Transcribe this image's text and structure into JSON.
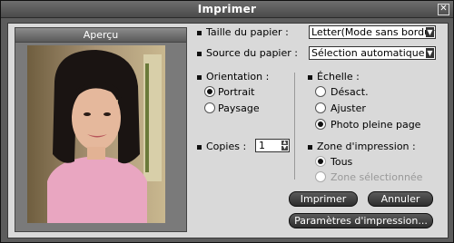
{
  "window": {
    "title": "Imprimer"
  },
  "preview": {
    "title": "Aperçu"
  },
  "paper_size": {
    "label": "Taille du papier :",
    "value": "Letter(Mode sans bordure)"
  },
  "paper_source": {
    "label": "Source du papier :",
    "value": "Sélection automatique"
  },
  "orientation": {
    "label": "Orientation :",
    "options": [
      "Portrait",
      "Paysage"
    ],
    "selected": "Portrait"
  },
  "scale": {
    "label": "Échelle :",
    "options": [
      "Désact.",
      "Ajuster",
      "Photo pleine page"
    ],
    "selected": "Photo pleine page"
  },
  "copies": {
    "label": "Copies :",
    "value": "1"
  },
  "print_area": {
    "label": "Zone d'impression :",
    "options": [
      "Tous",
      "Zone sélectionnée"
    ],
    "selected": "Tous"
  },
  "buttons": {
    "print": "Imprimer",
    "cancel": "Annuler",
    "settings": "Paramètres d'impression..."
  }
}
